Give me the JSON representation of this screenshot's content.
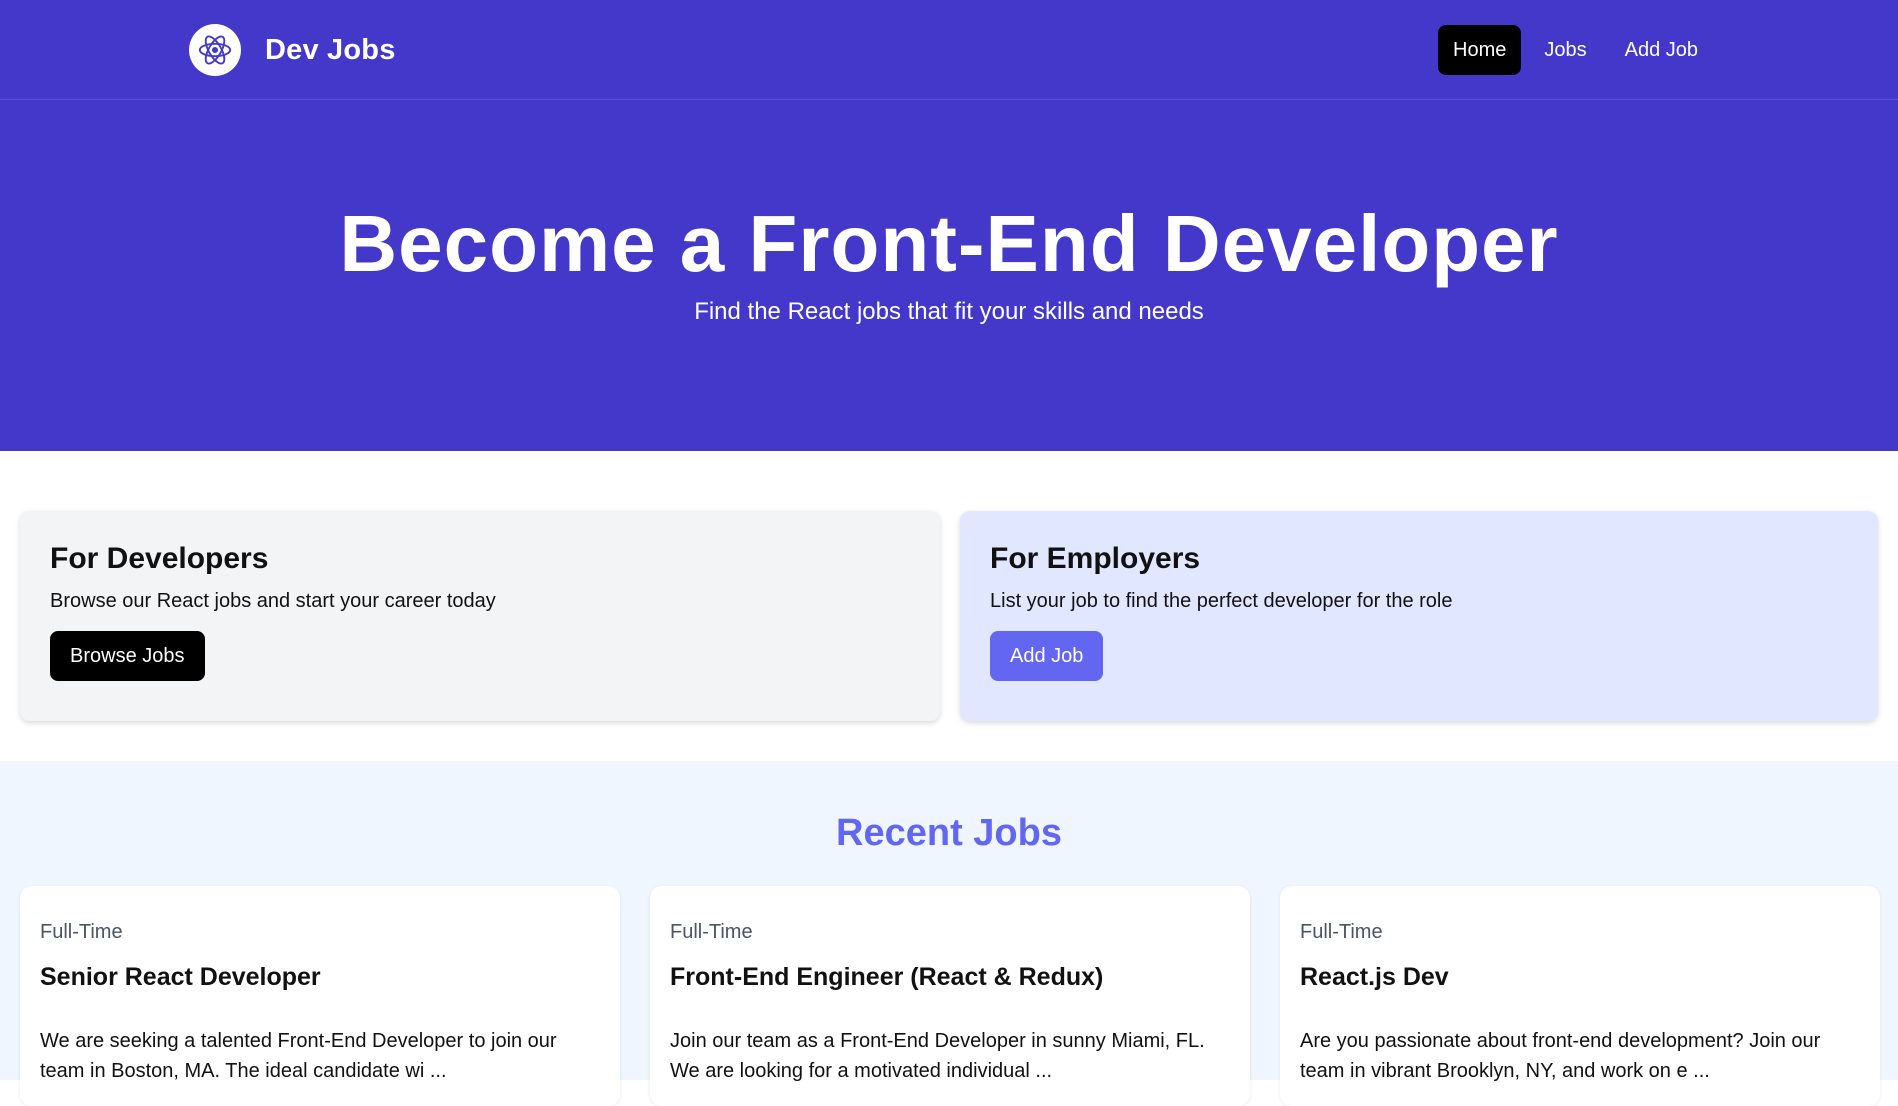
{
  "navbar": {
    "brand_title": "Dev Jobs",
    "brand_icon": "react-atom-icon",
    "links": [
      {
        "label": "Home",
        "active": true
      },
      {
        "label": "Jobs",
        "active": false
      },
      {
        "label": "Add Job",
        "active": false
      }
    ]
  },
  "hero": {
    "title": "Become a Front-End Developer",
    "subtitle": "Find the React jobs that fit your skills and needs"
  },
  "audience_cards": {
    "developers": {
      "title": "For Developers",
      "text": "Browse our React jobs and start your career today",
      "button_label": "Browse Jobs"
    },
    "employers": {
      "title": "For Employers",
      "text": "List your job to find the perfect developer for the role",
      "button_label": "Add Job"
    }
  },
  "recent_jobs": {
    "heading": "Recent Jobs",
    "jobs": [
      {
        "type": "Full-Time",
        "title": "Senior React Developer",
        "description": "We are seeking a talented Front-End Developer to join our team in Boston, MA. The ideal candidate wi ..."
      },
      {
        "type": "Full-Time",
        "title": "Front-End Engineer (React & Redux)",
        "description": "Join our team as a Front-End Developer in sunny Miami, FL. We are looking for a motivated individual ..."
      },
      {
        "type": "Full-Time",
        "title": "React.js Dev",
        "description": "Are you passionate about front-end development? Join our team in vibrant Brooklyn, NY, and work on e ..."
      }
    ]
  },
  "colors": {
    "brand_indigo": "#4338ca",
    "accent_indigo": "#6366f1",
    "developer_card_bg": "#f3f4f6",
    "employer_card_bg": "#e0e7ff",
    "jobs_section_bg": "#eff6ff"
  }
}
